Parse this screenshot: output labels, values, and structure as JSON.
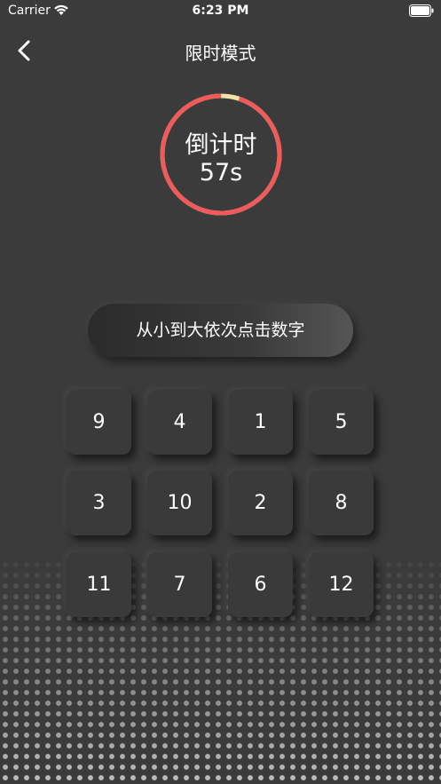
{
  "status_bar": {
    "carrier": "Carrier",
    "time": "6:23 PM"
  },
  "nav": {
    "title": "限时模式"
  },
  "timer": {
    "label": "倒计时",
    "value": "57s",
    "remaining_fraction": 0.95,
    "ring_color": "#f05a5a",
    "elapsed_color": "#f3e3a6"
  },
  "instruction": "从小到大依次点击数字",
  "grid": [
    "9",
    "4",
    "1",
    "5",
    "3",
    "10",
    "2",
    "8",
    "11",
    "7",
    "6",
    "12"
  ]
}
